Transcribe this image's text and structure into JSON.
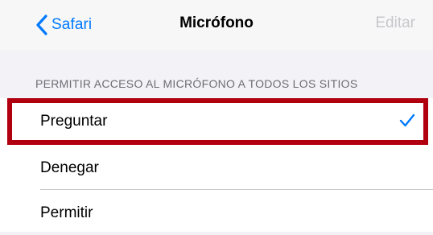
{
  "nav": {
    "back_label": "Safari",
    "title": "Micrófono",
    "edit_label": "Editar"
  },
  "section": {
    "header": "PERMITIR ACCESO AL MICRÓFONO A TODOS LOS SITIOS"
  },
  "options": [
    {
      "label": "Preguntar",
      "selected": true
    },
    {
      "label": "Denegar",
      "selected": false
    },
    {
      "label": "Permitir",
      "selected": false
    }
  ],
  "colors": {
    "accent": "#007aff",
    "highlight": "#b00010",
    "disabled": "#c7c7cc"
  },
  "icons": {
    "back": "chevron-left-icon",
    "selected": "checkmark-icon"
  }
}
